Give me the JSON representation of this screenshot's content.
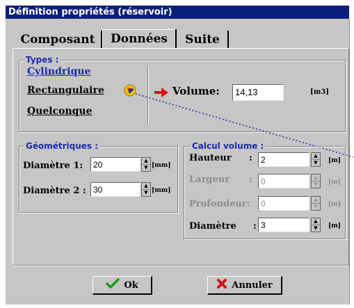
{
  "window": {
    "title": "Définition propriétés (réservoir)"
  },
  "tabs": [
    {
      "label": "Composant"
    },
    {
      "label": "Données"
    },
    {
      "label": "Suite"
    }
  ],
  "types": {
    "title": "Types :",
    "options": [
      {
        "label": "Cylindrique",
        "color": "#1b2bb0"
      },
      {
        "label": "Rectangulaire",
        "color": "#000000"
      },
      {
        "label": "Quelconque",
        "color": "#000000"
      }
    ],
    "volume": {
      "label": "Volume:",
      "value": "14,13",
      "unit": "[m3]"
    }
  },
  "geometriques": {
    "title": "Géométriques :",
    "fields": [
      {
        "label": "Diamètre 1:",
        "value": "20",
        "unit": "[mm]"
      },
      {
        "label": "Diamètre 2 :",
        "value": "30",
        "unit": "[mm]"
      }
    ]
  },
  "calcul": {
    "title": "Calcul volume :",
    "fields": [
      {
        "label": "Hauteur",
        "value": "2",
        "unit": "[m]",
        "enabled": true
      },
      {
        "label": "Largeur",
        "value": "0",
        "unit": "[m]",
        "enabled": false
      },
      {
        "label": "Profondeur:",
        "value": "0",
        "unit": "[m]",
        "enabled": false
      },
      {
        "label": "Diamètre",
        "value": "3",
        "unit": "[m]",
        "enabled": true
      }
    ]
  },
  "buttons": {
    "ok": "Ok",
    "cancel": "Annuler"
  },
  "colors": {
    "title_bar": "#0a1f7a",
    "face": "#c6c6c6",
    "accent": "#1b2bb0"
  }
}
